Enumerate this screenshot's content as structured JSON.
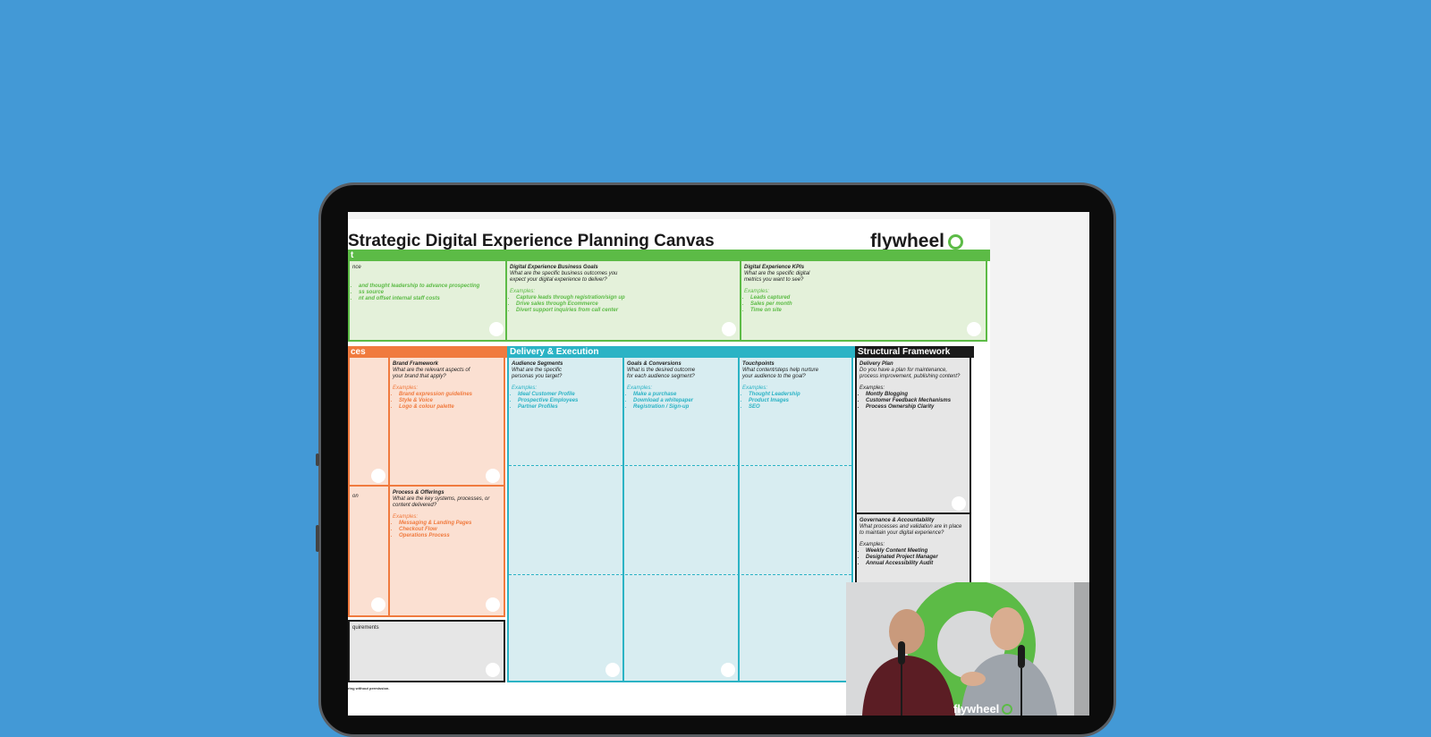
{
  "canvas": {
    "title": "Strategic Digital Experience Planning Canvas",
    "brand": "flywheel",
    "top_header_fragment": "t",
    "top_cells": [
      {
        "title": "",
        "question": "nce",
        "examples_label": "",
        "items": [
          "and thought leadership to advance prospecting",
          "ss source",
          "nt and offset internal staff costs"
        ]
      },
      {
        "title": "Digital Experience Business Goals",
        "question": "What are the specific business outcomes you expect your digital experience to deliver?",
        "examples_label": "Examples:",
        "items": [
          "Capture leads through registration/sign up",
          "Drive sales through Ecommerce",
          "Divert support inquiries from call center"
        ]
      },
      {
        "title": "Digital Experience KPIs",
        "question": "What are the specific digital metrics you want to see?",
        "examples_label": "Examples:",
        "items": [
          "Leads captured",
          "Sales per month",
          "Time on site"
        ]
      }
    ],
    "left_section": {
      "header": "ces",
      "brand_framework": {
        "title": "Brand Framework",
        "question": "What are the relevant aspects of your brand that apply?",
        "examples_label": "Examples:",
        "items": [
          "Brand expression guidelines",
          "Style & Voice",
          "Logo & colour palette"
        ]
      },
      "left_fragment": "on",
      "process": {
        "title": "Process & Offerings",
        "question": "What are the key systems, processes, or content delivered?",
        "examples_label": "Examples:",
        "items": [
          "Messaging & Landing Pages",
          "Checkout Flow",
          "Operations Process"
        ]
      },
      "requirements": "quirements"
    },
    "delivery": {
      "header": "Delivery & Execution",
      "columns": [
        {
          "title": "Audience Segments",
          "question": "What are the specific personas you target?",
          "examples_label": "Examples:",
          "items": [
            "Ideal Customer Profile",
            "Prospective Employees",
            "Partner Profiles"
          ]
        },
        {
          "title": "Goals & Conversions",
          "question": "What is the desired outcome for each audience segment?",
          "examples_label": "Examples:",
          "items": [
            "Make a purchase",
            "Download a whitepaper",
            "Registration / Sign-up"
          ]
        },
        {
          "title": "Touchpoints",
          "question": "What content/steps help nurture your audience to the goal?",
          "examples_label": "Examples:",
          "items": [
            "Thought Leadership",
            "Product Images",
            "SEO"
          ]
        }
      ]
    },
    "structural": {
      "header": "Structural Framework",
      "delivery_plan": {
        "title": "Delivery Plan",
        "question": "Do you have a plan for maintenance, process improvement, publishing content?",
        "examples_label": "Examples:",
        "items": [
          "Montly Blogging",
          "Customer Feedback Mechanisms",
          "Process Ownership Clarity"
        ]
      },
      "governance": {
        "title": "Governance & Accountability",
        "question": "What processes and validation are in place to maintain your digital experience?",
        "examples_label": "Examples:",
        "items": [
          "Weekly Content Meeting",
          "Designated Project Manager",
          "Annual Accessibility Audit"
        ]
      }
    },
    "footnote": "ring without permission."
  },
  "video": {
    "brand": "flywheel"
  },
  "colors": {
    "background": "#4399d6",
    "green": "#5cbb46",
    "orange": "#f07a3e",
    "teal": "#2bb3c5",
    "black": "#1a1a1a"
  }
}
